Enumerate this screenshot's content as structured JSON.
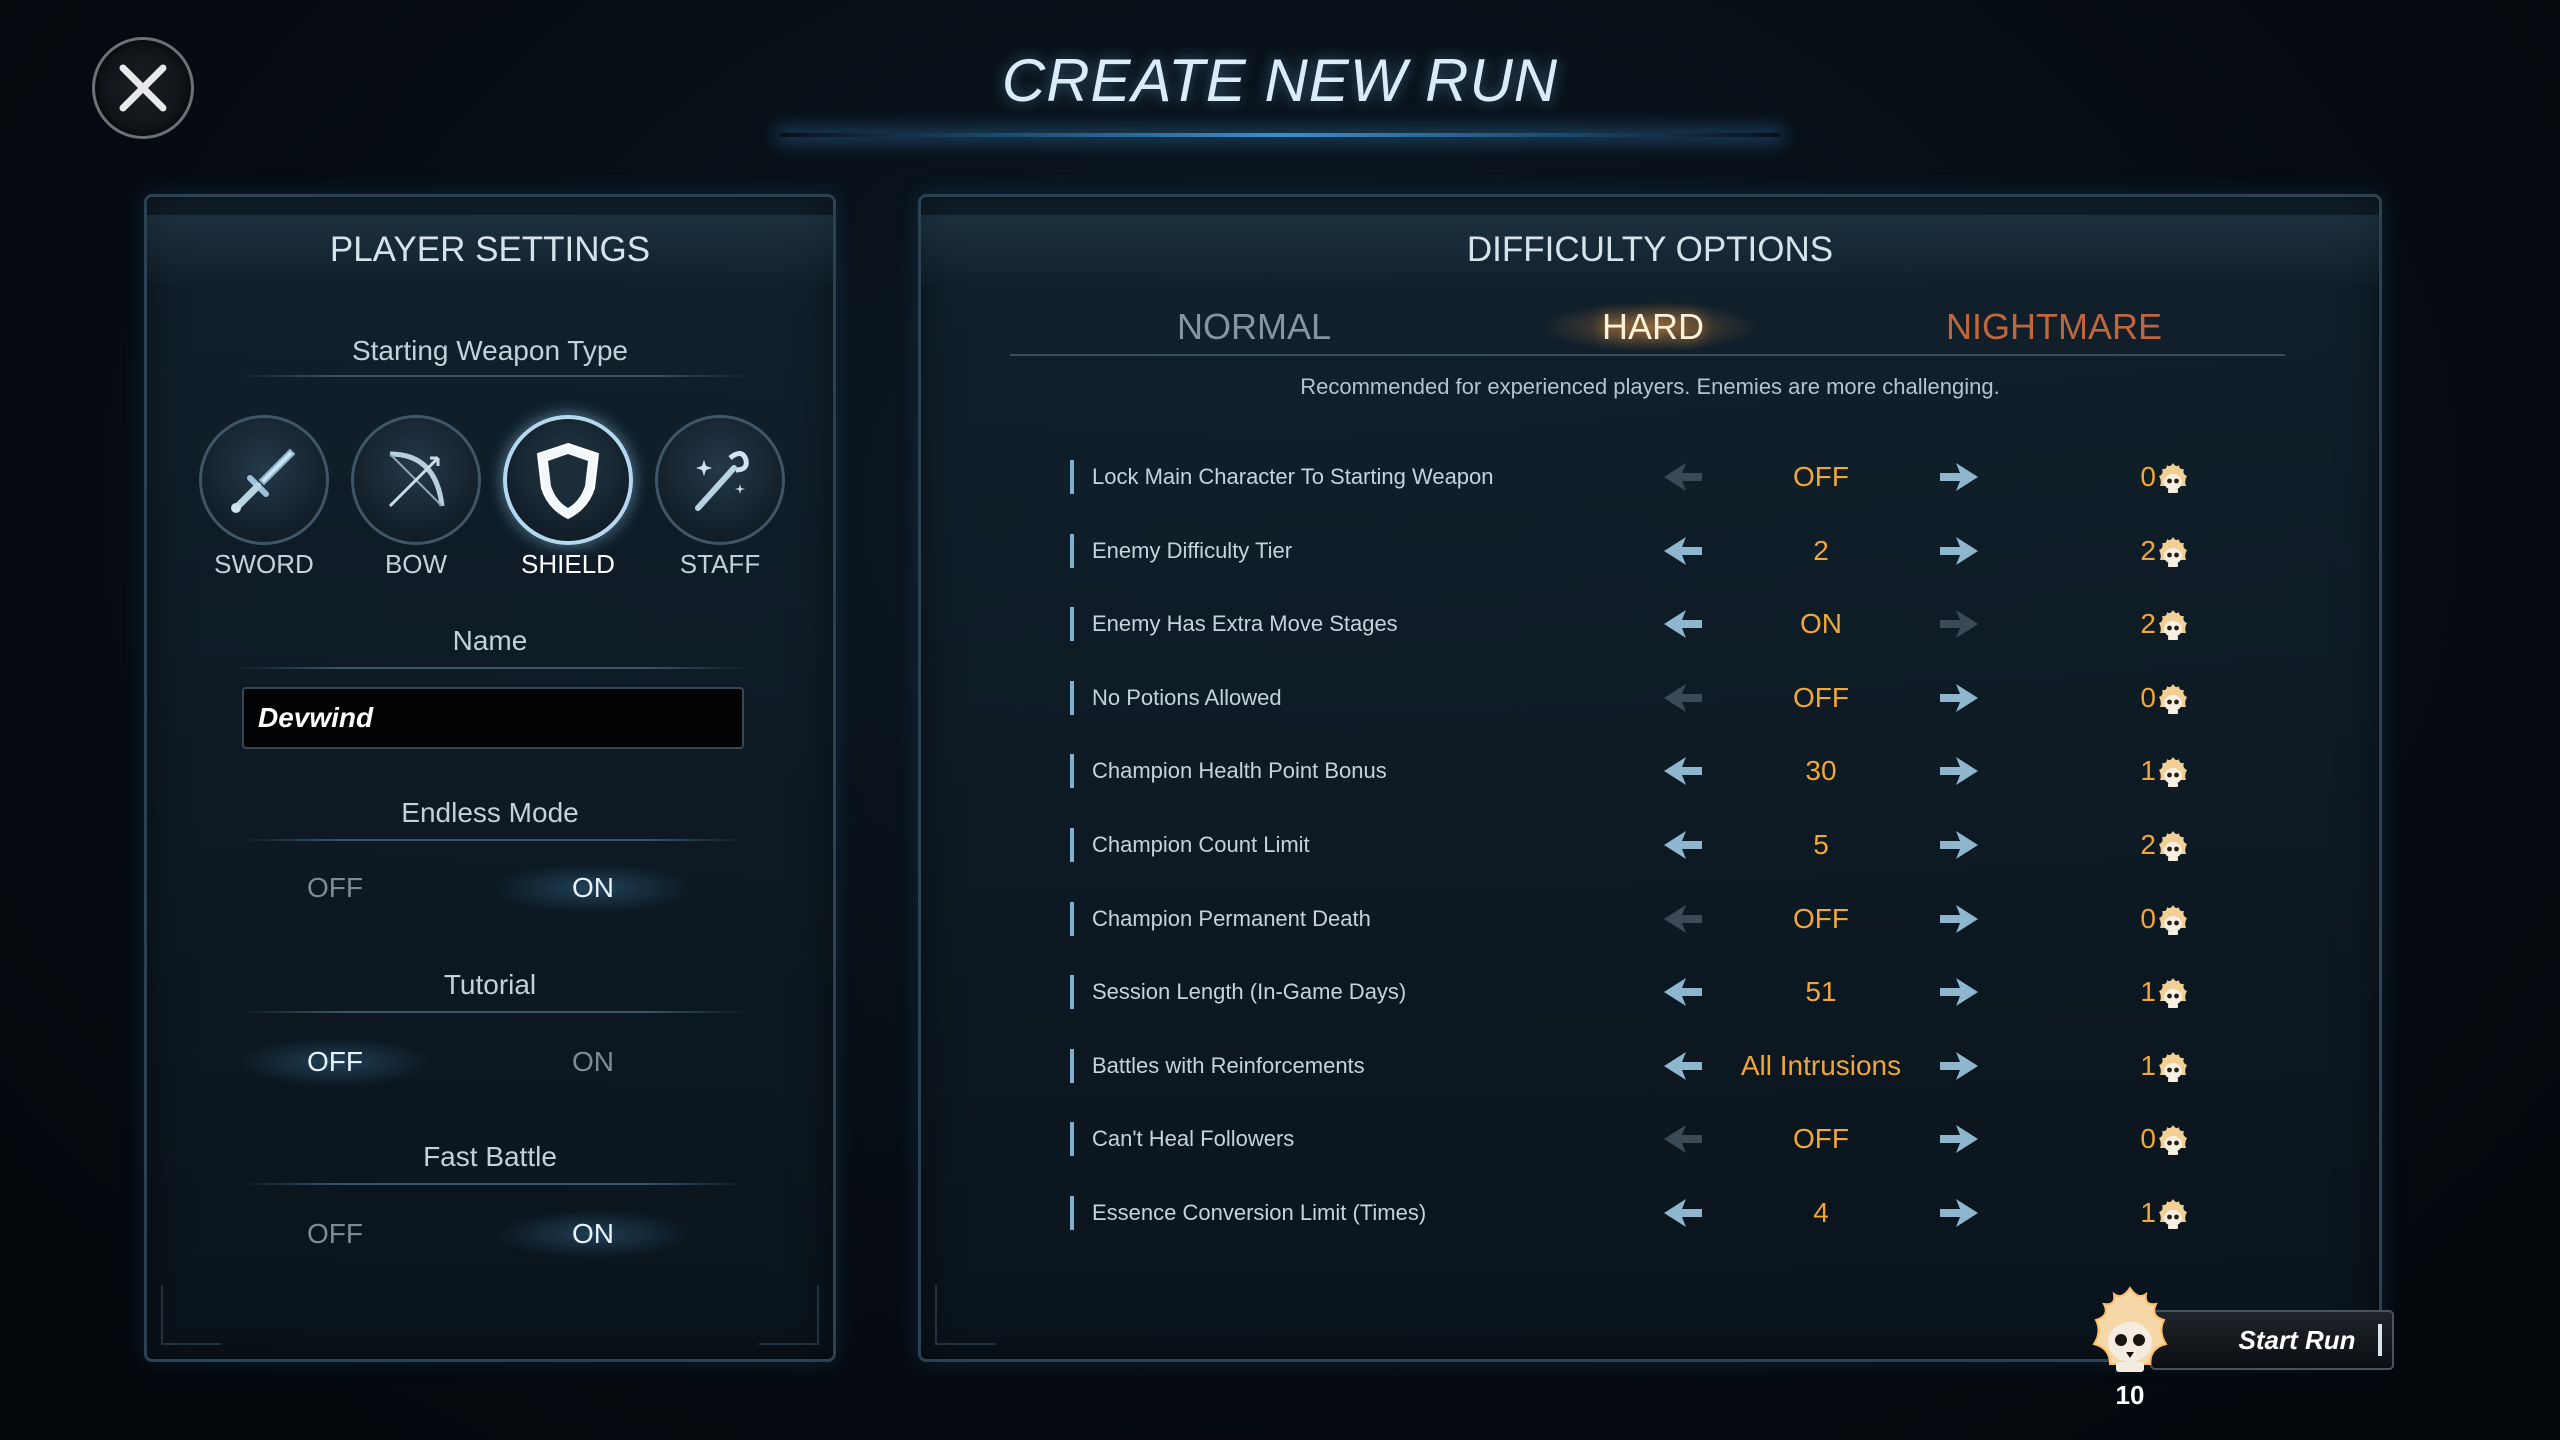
{
  "title": "CREATE NEW RUN",
  "player_settings": {
    "heading": "PLAYER SETTINGS",
    "weapon_type_label": "Starting Weapon Type",
    "weapons": [
      {
        "label": "SWORD",
        "icon": "sword-icon"
      },
      {
        "label": "BOW",
        "icon": "bow-icon"
      },
      {
        "label": "SHIELD",
        "icon": "shield-icon"
      },
      {
        "label": "STAFF",
        "icon": "staff-icon"
      }
    ],
    "selected_weapon": "SHIELD",
    "name_label": "Name",
    "name_value": "Devwind",
    "endless_mode": {
      "label": "Endless Mode",
      "off": "OFF",
      "on": "ON",
      "selected": "ON"
    },
    "tutorial": {
      "label": "Tutorial",
      "off": "OFF",
      "on": "ON",
      "selected": "OFF"
    },
    "fast_battle": {
      "label": "Fast Battle",
      "off": "OFF",
      "on": "ON",
      "selected": "ON"
    }
  },
  "difficulty": {
    "heading": "DIFFICULTY OPTIONS",
    "tabs": [
      "NORMAL",
      "HARD",
      "NIGHTMARE"
    ],
    "selected_tab": "HARD",
    "description": "Recommended for experienced players. Enemies are more challenging.",
    "options": [
      {
        "label": "Lock Main Character To Starting Weapon",
        "value": "OFF",
        "points": "0",
        "left_enabled": false,
        "right_enabled": true
      },
      {
        "label": "Enemy Difficulty Tier",
        "value": "2",
        "points": "2",
        "left_enabled": true,
        "right_enabled": true
      },
      {
        "label": "Enemy Has Extra Move Stages",
        "value": "ON",
        "points": "2",
        "left_enabled": true,
        "right_enabled": false
      },
      {
        "label": "No Potions Allowed",
        "value": "OFF",
        "points": "0",
        "left_enabled": false,
        "right_enabled": true
      },
      {
        "label": "Champion Health Point Bonus",
        "value": "30",
        "points": "1",
        "left_enabled": true,
        "right_enabled": true
      },
      {
        "label": "Champion Count Limit",
        "value": "5",
        "points": "2",
        "left_enabled": true,
        "right_enabled": true
      },
      {
        "label": "Champion Permanent Death",
        "value": "OFF",
        "points": "0",
        "left_enabled": false,
        "right_enabled": true
      },
      {
        "label": "Session Length (In-Game Days)",
        "value": "51",
        "points": "1",
        "left_enabled": true,
        "right_enabled": true
      },
      {
        "label": "Battles with Reinforcements",
        "value": "All Intrusions",
        "points": "1",
        "left_enabled": true,
        "right_enabled": true
      },
      {
        "label": "Can't Heal Followers",
        "value": "OFF",
        "points": "0",
        "left_enabled": false,
        "right_enabled": true
      },
      {
        "label": "Essence Conversion Limit (Times)",
        "value": "4",
        "points": "1",
        "left_enabled": true,
        "right_enabled": true
      }
    ]
  },
  "start_run": {
    "label": "Start Run",
    "total": "10"
  },
  "colors": {
    "accent_value": "#f0a73a",
    "hard_glow": "#ffaa50",
    "nightmare": "#c0663d",
    "arrow_enabled": "#8fb6cf",
    "arrow_disabled": "#3c4a55"
  }
}
